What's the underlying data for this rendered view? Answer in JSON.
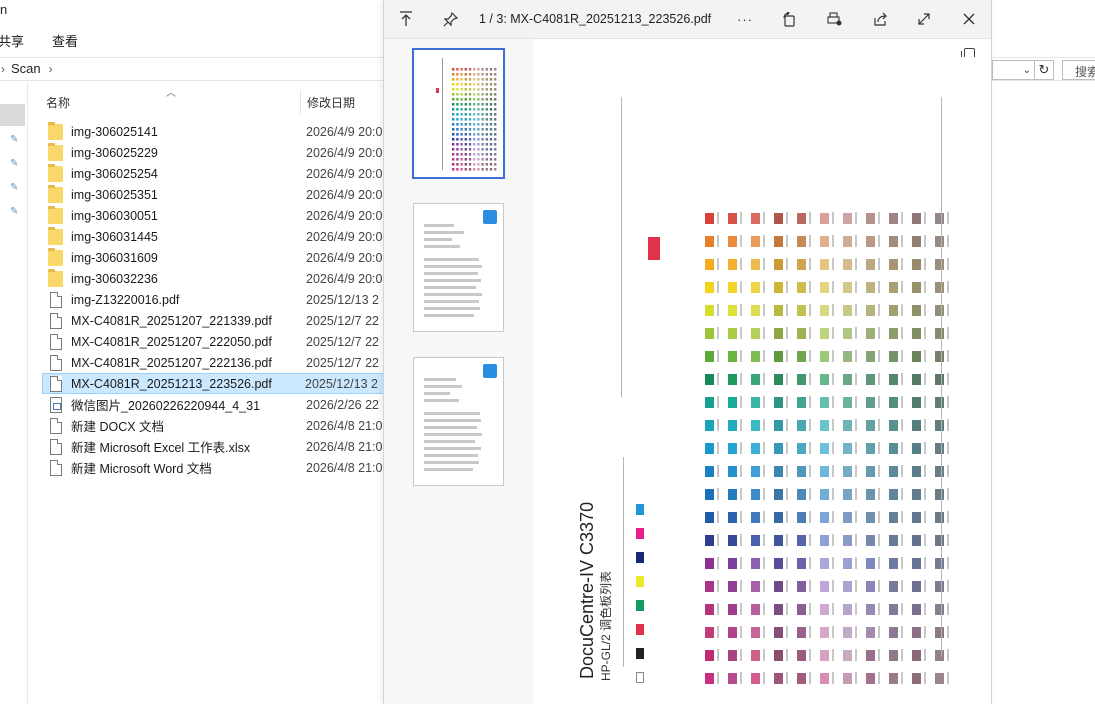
{
  "explorer": {
    "title_fragment": "n",
    "ribbon": [
      "共享",
      "查看"
    ],
    "breadcrumb": {
      "current": "Scan"
    },
    "search_placeholder": "搜索",
    "columns": {
      "name": "名称",
      "date": "修改日期"
    },
    "files": [
      {
        "type": "folder",
        "name": "img-306025141",
        "date": "2026/4/9 20:0"
      },
      {
        "type": "folder",
        "name": "img-306025229",
        "date": "2026/4/9 20:0"
      },
      {
        "type": "folder",
        "name": "img-306025254",
        "date": "2026/4/9 20:0"
      },
      {
        "type": "folder",
        "name": "img-306025351",
        "date": "2026/4/9 20:0"
      },
      {
        "type": "folder",
        "name": "img-306030051",
        "date": "2026/4/9 20:0"
      },
      {
        "type": "folder",
        "name": "img-306031445",
        "date": "2026/4/9 20:0"
      },
      {
        "type": "folder",
        "name": "img-306031609",
        "date": "2026/4/9 20:0"
      },
      {
        "type": "folder",
        "name": "img-306032236",
        "date": "2026/4/9 20:0"
      },
      {
        "type": "pdf",
        "name": "img-Z13220016.pdf",
        "date": "2025/12/13 2"
      },
      {
        "type": "pdf",
        "name": "MX-C4081R_20251207_221339.pdf",
        "date": "2025/12/7 22"
      },
      {
        "type": "pdf",
        "name": "MX-C4081R_20251207_222050.pdf",
        "date": "2025/12/7 22"
      },
      {
        "type": "pdf",
        "name": "MX-C4081R_20251207_222136.pdf",
        "date": "2025/12/7 22"
      },
      {
        "type": "pdf",
        "name": "MX-C4081R_20251213_223526.pdf",
        "date": "2025/12/13 2",
        "selected": true
      },
      {
        "type": "image",
        "name": "微信图片_20260226220944_4_31",
        "date": "2026/2/26 22"
      },
      {
        "type": "doc",
        "name": "新建 DOCX 文档",
        "date": "2026/4/8 21:0"
      },
      {
        "type": "doc",
        "name": "新建 Microsoft Excel 工作表.xlsx",
        "date": "2026/4/8 21:0"
      },
      {
        "type": "doc",
        "name": "新建 Microsoft Word 文档",
        "date": "2026/4/8 21:0"
      }
    ]
  },
  "viewer": {
    "title": "1 / 3: MX-C4081R_20251213_223526.pdf",
    "toolbar_icons": [
      "pin-top-icon",
      "pin-icon",
      "more-icon",
      "rotate-icon",
      "print-icon",
      "share-icon",
      "expand-icon",
      "close-icon"
    ],
    "more_glyph": "···",
    "thumbnails": [
      {
        "page": 1,
        "active": true
      },
      {
        "page": 2
      },
      {
        "page": 3
      }
    ],
    "page_content": {
      "title": "DocuCentre-IV C3370",
      "subtitle": "HP-GL/2 调色板列表"
    }
  }
}
